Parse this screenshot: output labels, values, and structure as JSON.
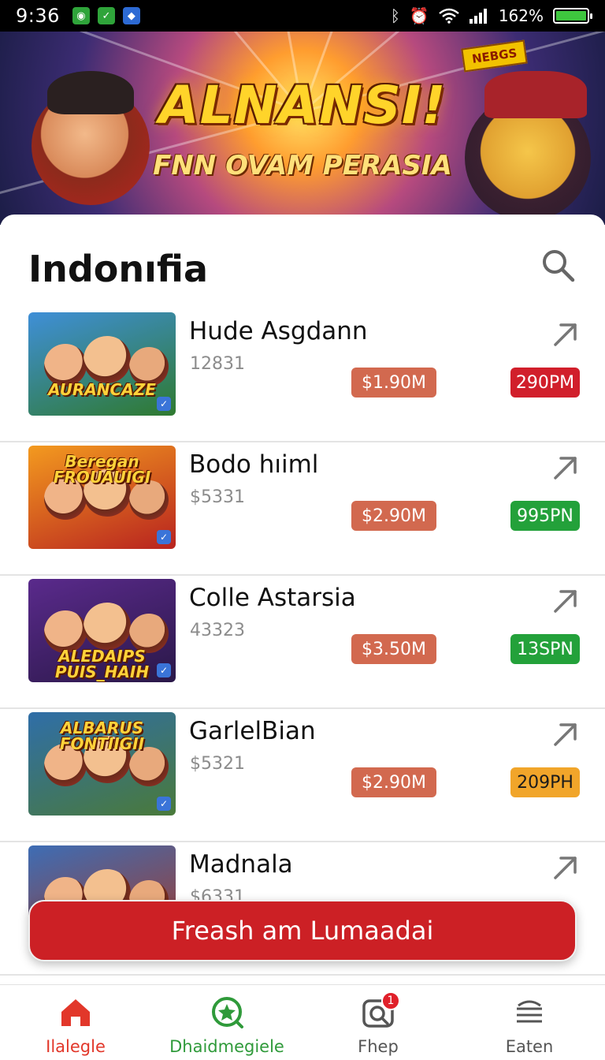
{
  "status_bar": {
    "time": "9:36",
    "battery": "162%",
    "battery_level": 1.0,
    "icons": [
      "notification-app-green",
      "notification-app-green-check",
      "notification-app-blue",
      "bluetooth-icon",
      "alarm-icon",
      "wifi-icon",
      "signal-icon",
      "battery-icon"
    ]
  },
  "banner": {
    "title": "ALNANSI!",
    "subtitle": "FNN OVAM PERASIA",
    "badge": "NEBGS"
  },
  "header": {
    "title": "Indonıfia",
    "search_icon": "search-icon"
  },
  "games": [
    {
      "name": "Hude Asgdann",
      "sub": "12831",
      "price": "$1.90M",
      "tag": "290PM",
      "tag_color": "#d11f2b",
      "thumb_title": "AURANCAZE",
      "thumb_colors": [
        "#3f8fd8",
        "#2f7a2f"
      ]
    },
    {
      "name": "Bodo hıiml",
      "sub": "$5331",
      "price": "$2.90M",
      "tag": "995PN",
      "tag_color": "#23a13a",
      "thumb_title": "Beregan FROUAUIGI",
      "thumb_colors": [
        "#f39a1f",
        "#b8231f"
      ]
    },
    {
      "name": "Colle Astarsia",
      "sub": "43323",
      "price": "$3.50M",
      "tag": "13SPN",
      "tag_color": "#23a13a",
      "thumb_title": "ALEDAIPS PUIS_HAIH",
      "thumb_colors": [
        "#5a2a8c",
        "#2a1848"
      ]
    },
    {
      "name": "GarlelBian",
      "sub": "$5321",
      "price": "$2.90M",
      "tag": "209PH",
      "tag_color": "#f1a52a",
      "thumb_title": "ALBARUS FONTIIGII",
      "thumb_colors": [
        "#2f6ea8",
        "#4a7a3a"
      ]
    },
    {
      "name": "Madnala",
      "sub": "$6331",
      "price": "",
      "tag": "",
      "tag_color": "#23a13a",
      "thumb_title": "",
      "thumb_colors": [
        "#3d6db5",
        "#a33a2a"
      ]
    }
  ],
  "cta": {
    "label": "Freash am Lumaadai"
  },
  "bottom_nav": [
    {
      "label": "Ilalegle",
      "icon": "home-icon",
      "color": "#e2372a"
    },
    {
      "label": "Dhaidmegiele",
      "icon": "explore-icon",
      "color": "#2f9a3a"
    },
    {
      "label": "Fhep",
      "icon": "camera-search-icon",
      "color": "#555555",
      "badge": "1"
    },
    {
      "label": "Eaten",
      "icon": "menu-icon",
      "color": "#555555"
    }
  ]
}
